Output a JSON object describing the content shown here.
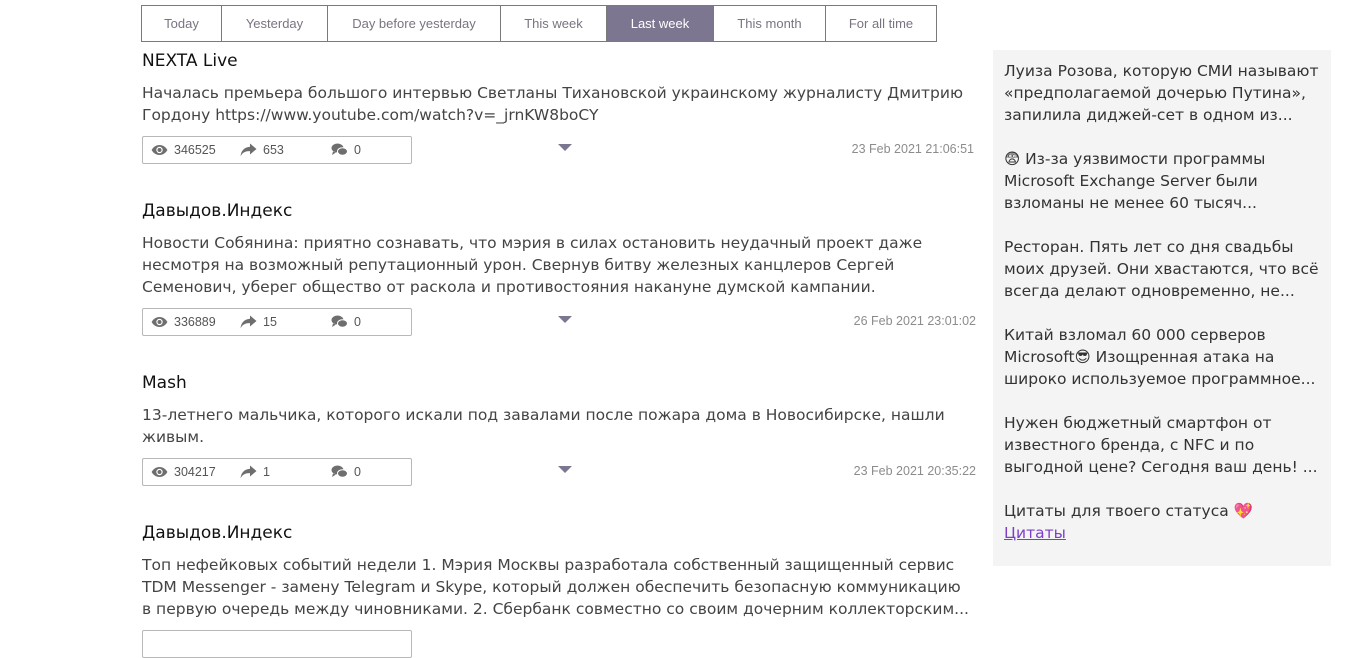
{
  "tabs": [
    {
      "label": "Today",
      "active": false
    },
    {
      "label": "Yesterday",
      "active": false
    },
    {
      "label": "Day before yesterday",
      "active": false
    },
    {
      "label": "This week",
      "active": false
    },
    {
      "label": "Last week",
      "active": true
    },
    {
      "label": "This month",
      "active": false
    },
    {
      "label": "For all time",
      "active": false
    }
  ],
  "posts": [
    {
      "author": "NEXTA Live",
      "text": "Началась премьера большого интервью Светланы Тихановской украинскому журналисту Дмитрию Гордону https://www.youtube.com/watch?v=_jrnKW8boCY",
      "views": "346525",
      "shares": "653",
      "comments": "0",
      "date": "23 Feb 2021 21:06:51"
    },
    {
      "author": "Давыдов.Индекс",
      "text": "Новости Собянина: приятно сознавать, что мэрия в силах остановить неудачный проект даже несмотря на возможный репутационный урон. Свернув битву железных канцлеров Сергей Семенович, уберег общество от раскола и противостояния накануне думской кампании.",
      "views": "336889",
      "shares": "15",
      "comments": "0",
      "date": "26 Feb 2021 23:01:02"
    },
    {
      "author": "Mash",
      "text": "13-летнего мальчика, которого искали под завалами после пожара дома в Новосибирске, нашли живым.",
      "views": "304217",
      "shares": "1",
      "comments": "0",
      "date": "23 Feb 2021 20:35:22"
    },
    {
      "author": "Давыдов.Индекс",
      "text": "Топ нефейковых событий недели 1. Мэрия Москвы разработала собственный защищенный сервис TDM Messenger - замену Telegram и Skype, который должен обеспечить безопасную коммуникацию в первую очередь между чиновниками. 2. Сбербанк совместно со своим дочерним коллекторским..."
    }
  ],
  "sidebar": {
    "items": [
      {
        "text": "Луиза Розова, которую СМИ называют «предполагаемой дочерью Путина», запилила диджей-сет в одном из..."
      },
      {
        "text": "😨 Из-за уязвимости программы Microsoft Exchange Server были взломаны не менее 60 тысяч..."
      },
      {
        "text": "Ресторан. Пять лет со дня свадьбы моих друзей. Они хвастаются, что всё всегда делают одновременно, не..."
      },
      {
        "text": "Китай взломал 60 000 серверов Microsoft😎 Изощренная атака на широко используемое программное..."
      },
      {
        "text": "Нужен бюджетный смартфон от известного бренда, с NFC и по выгодной цене? Сегодня ваш день! ..."
      },
      {
        "text": "Цитаты для твоего статуса 💖",
        "link": "Цитаты"
      }
    ]
  },
  "colors": {
    "active_tab": "#7c7690",
    "icon": "#6e6e6e",
    "link": "#7b3fc8",
    "sidebar_bg": "#f4f4f4"
  }
}
